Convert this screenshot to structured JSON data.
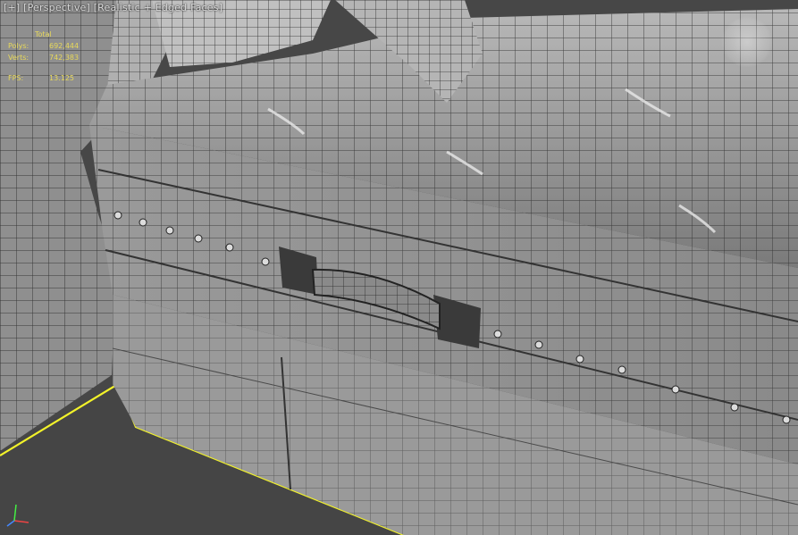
{
  "viewport": {
    "label": "[+] [Perspective] [Realistic + Edged Faces]"
  },
  "stats": [
    {
      "key": "Polys:",
      "value": "692,444"
    },
    {
      "key": "Verts:",
      "value": "742,383"
    },
    {
      "key": "FPS:",
      "value": "13.125"
    }
  ],
  "stats_header": "Total",
  "colors": {
    "selection_outline": "#f2f22a",
    "mesh": "#8e8e8e",
    "wire": "#2a2a2a",
    "floor": "#454545"
  },
  "icons": {
    "viewcube": "viewcube-icon",
    "axis": "axis-tripod-icon"
  }
}
